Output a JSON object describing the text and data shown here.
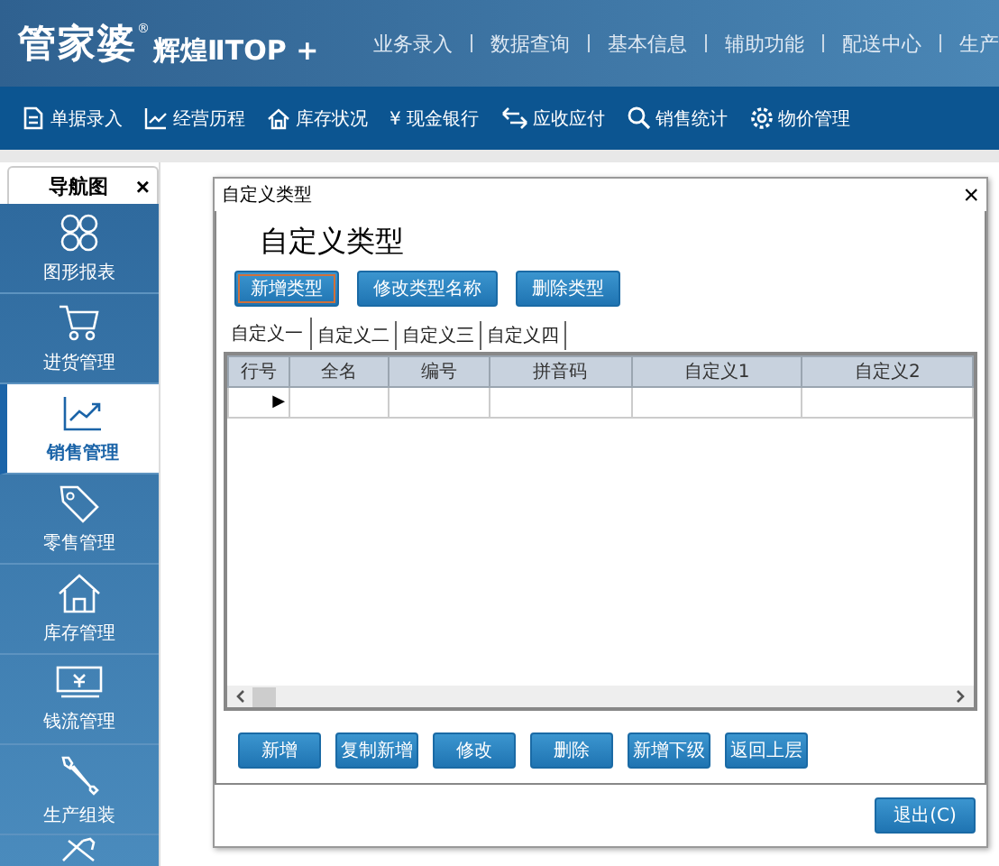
{
  "logo": {
    "brand": "管家婆",
    "mark": "®",
    "product": "辉煌ⅡTOP +"
  },
  "top_menu": [
    "业务录入",
    "数据查询",
    "基本信息",
    "辅助功能",
    "配送中心",
    "生产"
  ],
  "toolbar": [
    "单据录入",
    "经营历程",
    "库存状况",
    "¥ 现金银行",
    "应收应付",
    "销售统计",
    "物价管理"
  ],
  "nav_tab": {
    "label": "导航图",
    "close": "×"
  },
  "nav_items": [
    {
      "label": "图形报表",
      "selected": false
    },
    {
      "label": "进货管理",
      "selected": false
    },
    {
      "label": "销售管理",
      "selected": true
    },
    {
      "label": "零售管理",
      "selected": false
    },
    {
      "label": "库存管理",
      "selected": false
    },
    {
      "label": "钱流管理",
      "selected": false
    },
    {
      "label": "生产组装",
      "selected": false
    }
  ],
  "dialog": {
    "title": "自定义类型",
    "close": "×",
    "heading": "自定义类型",
    "type_buttons": [
      {
        "label": "新增类型",
        "focused": true
      },
      {
        "label": "修改类型名称",
        "focused": false
      },
      {
        "label": "删除类型",
        "focused": false
      }
    ],
    "tabs": [
      {
        "label": "自定义一",
        "selected": true
      },
      {
        "label": "自定义二",
        "selected": false
      },
      {
        "label": "自定义三",
        "selected": false
      },
      {
        "label": "自定义四",
        "selected": false
      }
    ],
    "table": {
      "columns": [
        "行号",
        "全名",
        "编号",
        "拼音码",
        "自定义1",
        "自定义2"
      ],
      "rows": [
        {
          "marker": "▶"
        }
      ]
    },
    "actions": [
      "新增",
      "复制新增",
      "修改",
      "删除",
      "新增下级",
      "返回上层"
    ],
    "exit": "退出(C)"
  }
}
